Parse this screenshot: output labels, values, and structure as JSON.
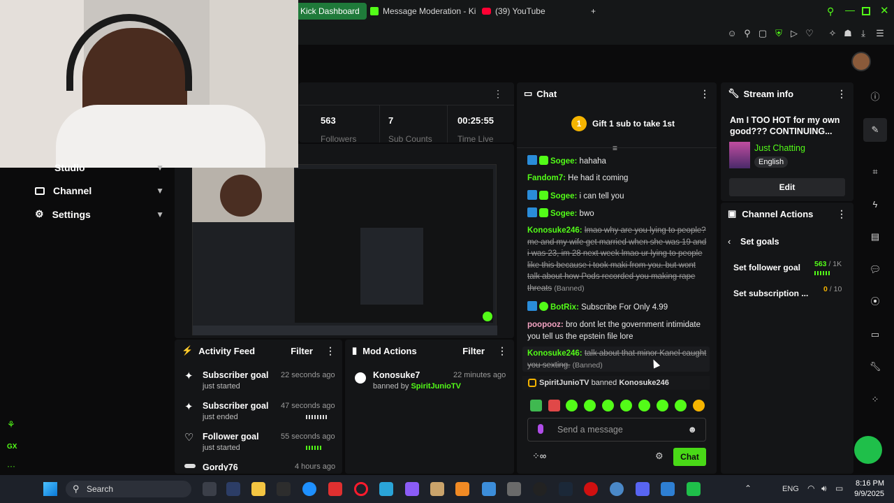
{
  "browser": {
    "tabs": [
      {
        "label": "Kick Dashboard",
        "active": true
      },
      {
        "label": "Message Moderation - Ki",
        "active": false
      },
      {
        "label": "(39) YouTube",
        "active": false
      }
    ],
    "new_tab_label": "+"
  },
  "sidebar": {
    "items": [
      {
        "label": "Studio"
      },
      {
        "label": "Channel"
      },
      {
        "label": "Settings"
      }
    ],
    "bottom_label": "GX"
  },
  "stats": {
    "followers_value": "563",
    "followers_label": "Followers",
    "subs_value": "7",
    "subs_label": "Sub Counts",
    "time_value": "00:25:55",
    "time_label": "Time Live"
  },
  "chat": {
    "title": "Chat",
    "pinned": "Gift 1 sub to take 1st",
    "pinned_rank": "1",
    "messages": [
      {
        "user": "Sogee",
        "text": "hahaha",
        "badges": "mod"
      },
      {
        "user": "Fandom7",
        "text": "He had it coming",
        "badges": ""
      },
      {
        "user": "Sogee",
        "text": "i can tell you",
        "badges": "mod"
      },
      {
        "user": "Sogee",
        "text": "bwo",
        "badges": "mod"
      }
    ],
    "banned_msg_1_user": "Konosuke246:",
    "banned_msg_1_text": "lmao why are you lying to people? me and my wife get married when she was 19 and i was 23, im 28 next week lmao ur lying to people like this because i took maki from you. but wont talk about how Pods recorded you making rape threats",
    "banned_tag": "(Banned)",
    "botrix_user": "BotRix",
    "botrix_text": "Subscribe For Only 4.99",
    "poopooz_user": "poopooz:",
    "poopooz_text": "bro dont let the government intimidate you tell us the epstein file lore",
    "banned_msg_2_user": "Konosuke246:",
    "banned_msg_2_text": "talk about that minor Kanel caught you sexting.",
    "ban_notice_actor": "SpiritJunioTV",
    "ban_notice_verb": "banned",
    "ban_notice_target": "Konosuke246",
    "input_placeholder": "Send a message",
    "send_label": "Chat"
  },
  "stream_info": {
    "title": "Stream info",
    "stream_title": "Am I TOO HOT for my own good??? CONTINUING...",
    "category": "Just Chatting",
    "language": "English",
    "edit_label": "Edit"
  },
  "channel_actions": {
    "title": "Channel Actions",
    "back_label": "Set goals",
    "goals": [
      {
        "label": "Set follower goal",
        "current": "563",
        "target": "/ 1K"
      },
      {
        "label": "Set subscription ...",
        "current": "0",
        "target": "/ 10"
      }
    ]
  },
  "activity_feed": {
    "title": "Activity Feed",
    "filter_label": "Filter",
    "items": [
      {
        "title": "Subscriber goal",
        "sub": "just started",
        "time": "22 seconds ago"
      },
      {
        "title": "Subscriber goal",
        "sub": "just ended",
        "time": "47 seconds ago"
      },
      {
        "title": "Follower goal",
        "sub": "just started",
        "time": "55 seconds ago"
      },
      {
        "title": "Gordy76",
        "sub": "",
        "time": "4 hours ago"
      }
    ]
  },
  "mod_actions": {
    "title": "Mod Actions",
    "filter_label": "Filter",
    "items": [
      {
        "user": "Konosuke7",
        "prefix": "banned by",
        "actor": "SpiritJunioTV",
        "time": "22 minutes ago"
      }
    ]
  },
  "taskbar": {
    "search_label": "Search",
    "lang": "ENG",
    "time": "8:16 PM",
    "date": "9/9/2025"
  },
  "colors": {
    "accent": "#53fc18",
    "background": "#0b0b0c",
    "panel": "#141517"
  }
}
